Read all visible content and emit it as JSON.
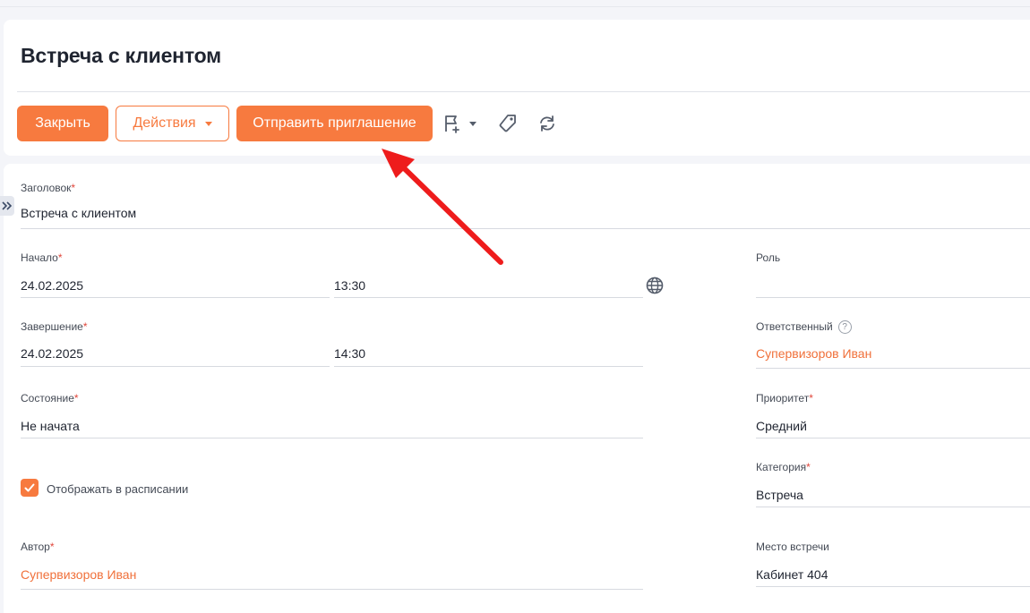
{
  "header": {
    "title": "Встреча с клиентом",
    "buttons": {
      "close_label": "Закрыть",
      "actions_label": "Действия",
      "invite_label": "Отправить приглашение"
    },
    "icons": [
      "flag-plus-icon",
      "tag-icon",
      "sync-icon"
    ]
  },
  "form": {
    "subject": {
      "label": "Заголовок",
      "value": "Встреча с клиентом"
    },
    "start": {
      "label": "Начало",
      "date": "24.02.2025",
      "time": "13:30"
    },
    "end": {
      "label": "Завершение",
      "date": "24.02.2025",
      "time": "14:30"
    },
    "status": {
      "label": "Состояние",
      "value": "Не начата"
    },
    "show_in_schedule": {
      "label": "Отображать в расписании",
      "checked": true
    },
    "author": {
      "label": "Автор",
      "value": "Супервизоров Иван"
    },
    "role": {
      "label": "Роль",
      "value": ""
    },
    "owner": {
      "label": "Ответственный",
      "value": "Супервизоров Иван"
    },
    "priority": {
      "label": "Приоритет",
      "value": "Средний"
    },
    "category": {
      "label": "Категория",
      "value": "Встреча"
    },
    "location": {
      "label": "Место встречи",
      "value": "Кабинет 404"
    },
    "required_mark": "*",
    "help_mark": "?"
  },
  "colors": {
    "accent": "#f77a3f",
    "link": "#f0703a",
    "required": "#e0463b",
    "annotation_arrow": "#ee1c1c"
  }
}
